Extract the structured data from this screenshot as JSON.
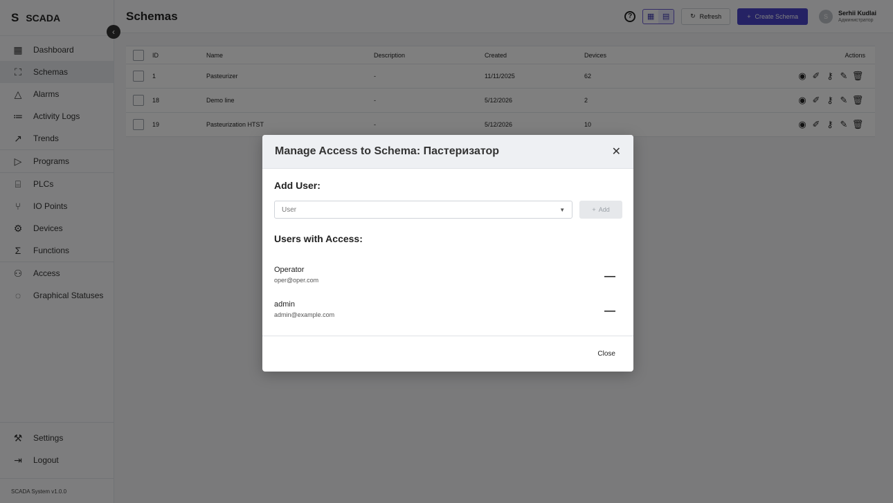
{
  "app": {
    "logo": "S",
    "name": "SCADA",
    "version": "SCADA System v1.0.0"
  },
  "sidebar": {
    "items": [
      {
        "label": "Dashboard",
        "icon": "dashboard-icon"
      },
      {
        "label": "Schemas",
        "icon": "schema-icon",
        "active": true
      },
      {
        "label": "Alarms",
        "icon": "bell-icon"
      },
      {
        "label": "Activity Logs",
        "icon": "list-icon"
      },
      {
        "label": "Trends",
        "icon": "trend-icon"
      },
      {
        "label": "Programs",
        "icon": "play-icon"
      },
      {
        "label": "PLCs",
        "icon": "plc-icon"
      },
      {
        "label": "IO Points",
        "icon": "io-icon"
      },
      {
        "label": "Devices",
        "icon": "gear-icon"
      },
      {
        "label": "Functions",
        "icon": "sigma-icon"
      },
      {
        "label": "Access",
        "icon": "users-icon"
      },
      {
        "label": "Graphical Statuses",
        "icon": "status-icon"
      }
    ],
    "bottom": [
      {
        "label": "Settings",
        "icon": "wrench-icon"
      },
      {
        "label": "Logout",
        "icon": "logout-icon"
      }
    ]
  },
  "header": {
    "title": "Schemas",
    "refresh_label": "Refresh",
    "create_label": "Create Schema",
    "user": {
      "initial": "S",
      "name": "Serhii Kudlai",
      "role": "Администратор"
    }
  },
  "table": {
    "headers": {
      "id": "ID",
      "name": "Name",
      "description": "Description",
      "created": "Created",
      "devices": "Devices",
      "actions": "Actions"
    },
    "rows": [
      {
        "id": "1",
        "name": "Pasteurizer",
        "description": "-",
        "created": "11/11/2025",
        "devices": "62"
      },
      {
        "id": "18",
        "name": "Demo line",
        "description": "-",
        "created": "5/12/2026",
        "devices": "2"
      },
      {
        "id": "19",
        "name": "Pasteurization HTST",
        "description": "-",
        "created": "5/12/2026",
        "devices": "10"
      }
    ]
  },
  "modal": {
    "title": "Manage Access to Schema: Пастеризатор",
    "add_user_title": "Add User:",
    "user_placeholder": "User",
    "add_label": "Add",
    "users_title": "Users with Access:",
    "users": [
      {
        "name": "Operator",
        "email": "oper@oper.com"
      },
      {
        "name": "admin",
        "email": "admin@example.com"
      }
    ],
    "close_label": "Close"
  }
}
